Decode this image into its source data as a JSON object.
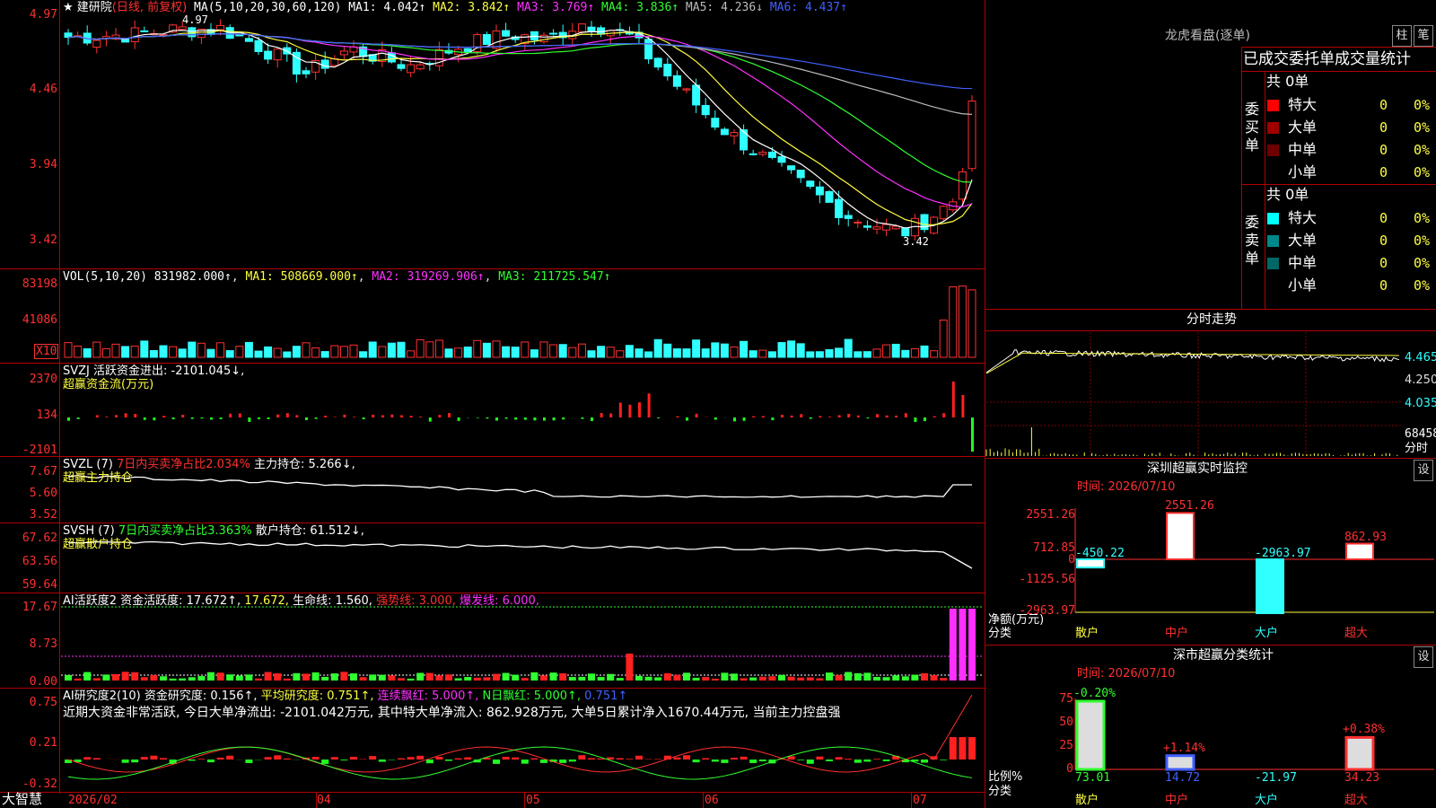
{
  "main": {
    "stock_label": "★ 建研院",
    "period_label": "(日线, 前复权)",
    "ma_header": "MA(5,10,20,30,60,120)",
    "ma_values": [
      {
        "label": "MA1: 4.042↑",
        "color": "#ffffff"
      },
      {
        "label": "MA2: 3.842↑",
        "color": "#ffff40"
      },
      {
        "label": "MA3: 3.769↑",
        "color": "#ff30ff"
      },
      {
        "label": "MA4: 3.836↑",
        "color": "#30ff30"
      },
      {
        "label": "MA5: 4.236↓",
        "color": "#bbbbbb"
      },
      {
        "label": "MA6: 4.437↑",
        "color": "#4060ff"
      }
    ],
    "y_ticks": [
      "4.97",
      "4.46",
      "3.94",
      "3.42"
    ],
    "high_note": "4.97",
    "low_note": "3.42"
  },
  "vol": {
    "header": "VOL(5,10,20) 831982.000↑",
    "ma1": "MA1: 508669.000↑",
    "ma2": "MA2: 319269.906↑",
    "ma3": "MA3: 211725.547↑",
    "y_ticks": [
      "83198",
      "41086"
    ],
    "unit": "X10"
  },
  "svzj": {
    "header": "SVZJ  活跃资金进出: -2101.045↓,",
    "subtitle": "超赢资金流(万元)",
    "y_ticks": [
      "2370",
      "134",
      "-2101"
    ]
  },
  "svzl": {
    "header": "SVZL (7)",
    "ratio": "7日内买卖净占比2.034%",
    "hold": "主力持仓: 5.266↓,",
    "subtitle": "超赢主力持仓",
    "y_ticks": [
      "7.67",
      "5.60",
      "3.52"
    ]
  },
  "svsh": {
    "header": "SVSH (7)",
    "ratio": "7日内买卖净占比3.363%",
    "hold": "散户持仓: 61.512↓,",
    "subtitle": "超赢散户持仓",
    "y_ticks": [
      "67.62",
      "63.56",
      "59.64"
    ]
  },
  "ai_active": {
    "header": "AI活跃度2 资金活跃度: 17.672↑,",
    "v2": "17.672,",
    "life": "生命线: 1.560,",
    "strong": "强势线: 3.000,",
    "burst": "爆发线: 6.000,",
    "y_ticks": [
      "17.67",
      "8.73",
      "0.00"
    ]
  },
  "ai_research": {
    "header": "AI研究度2(10) 资金研究度: 0.156↑,",
    "avg": "平均研究度: 0.751↑,",
    "cont": "连续飘红: 5.000↑,",
    "nday": "N日飘红: 5.000↑,",
    "last": "0.751↑",
    "summary": "近期大资金非常活跃, 今日大单净流出: -2101.042万元, 其中特大单净流入: 862.928万元, 大单5日累计净入1670.44万元, 当前主力控盘强",
    "y_ticks": [
      "0.75",
      "0.21",
      "-0.32"
    ]
  },
  "x_axis": {
    "brand": "大智慧",
    "labels": [
      "2026/02",
      "04",
      "05",
      "06",
      "07"
    ]
  },
  "dragon": {
    "title": "龙虎看盘(逐单)",
    "btn1": "柱",
    "btn2": "笔",
    "subtitle": "已成交委托单成交量统计",
    "buy_label": "委买单",
    "sell_label": "委卖单",
    "buy_total": "共 0单",
    "sell_total": "共 0单",
    "buy_rows": [
      {
        "name": "特大",
        "val": "0",
        "pct": "0%",
        "color": "#ff0000"
      },
      {
        "name": "大单",
        "val": "0",
        "pct": "0%",
        "color": "#a00000"
      },
      {
        "name": "中单",
        "val": "0",
        "pct": "0%",
        "color": "#700000"
      },
      {
        "name": "小单",
        "val": "0",
        "pct": "0%",
        "color": "#000000"
      }
    ],
    "sell_rows": [
      {
        "name": "特大",
        "val": "0",
        "pct": "0%",
        "color": "#00ffff"
      },
      {
        "name": "大单",
        "val": "0",
        "pct": "0%",
        "color": "#008888"
      },
      {
        "name": "中单",
        "val": "0",
        "pct": "0%",
        "color": "#006666"
      },
      {
        "name": "小单",
        "val": "0",
        "pct": "0%",
        "color": "#000000"
      }
    ]
  },
  "intraday": {
    "title": "分时走势",
    "y_ticks": [
      "4.465",
      "4.250",
      "4.035"
    ],
    "vol_label": "68458",
    "unit": "分时"
  },
  "sz_monitor": {
    "title": "深圳超赢实时监控",
    "settings": "设",
    "time": "时间: 2026/07/10",
    "y_ticks": [
      "2551.26",
      "712.85",
      "0",
      "-1125.56",
      "-2963.97"
    ],
    "y_unit": "净额(万元)",
    "x_unit": "分类",
    "bars": [
      {
        "cat": "散户",
        "value": -450.22,
        "label": "-450.22"
      },
      {
        "cat": "中户",
        "value": 2551.26,
        "label": "2551.26"
      },
      {
        "cat": "大户",
        "value": -2963.97,
        "label": "-2963.97"
      },
      {
        "cat": "超大",
        "value": 862.93,
        "label": "862.93"
      }
    ]
  },
  "sz_class": {
    "title": "深市超赢分类统计",
    "settings": "设",
    "time": "时间: 2026/07/10",
    "y_ticks": [
      "75",
      "50",
      "25",
      "0"
    ],
    "y_unit": "比例%",
    "x_unit": "分类",
    "bars": [
      {
        "cat": "散户",
        "value": 73.01,
        "change": "-0.20%",
        "label": "73.01"
      },
      {
        "cat": "中户",
        "value": 14.72,
        "change": "+1.14%",
        "label": "14.72"
      },
      {
        "cat": "大户",
        "value": -21.97,
        "change": "",
        "label": "-21.97"
      },
      {
        "cat": "超大",
        "value": 34.23,
        "change": "+0.38%",
        "label": "34.23"
      }
    ]
  }
}
